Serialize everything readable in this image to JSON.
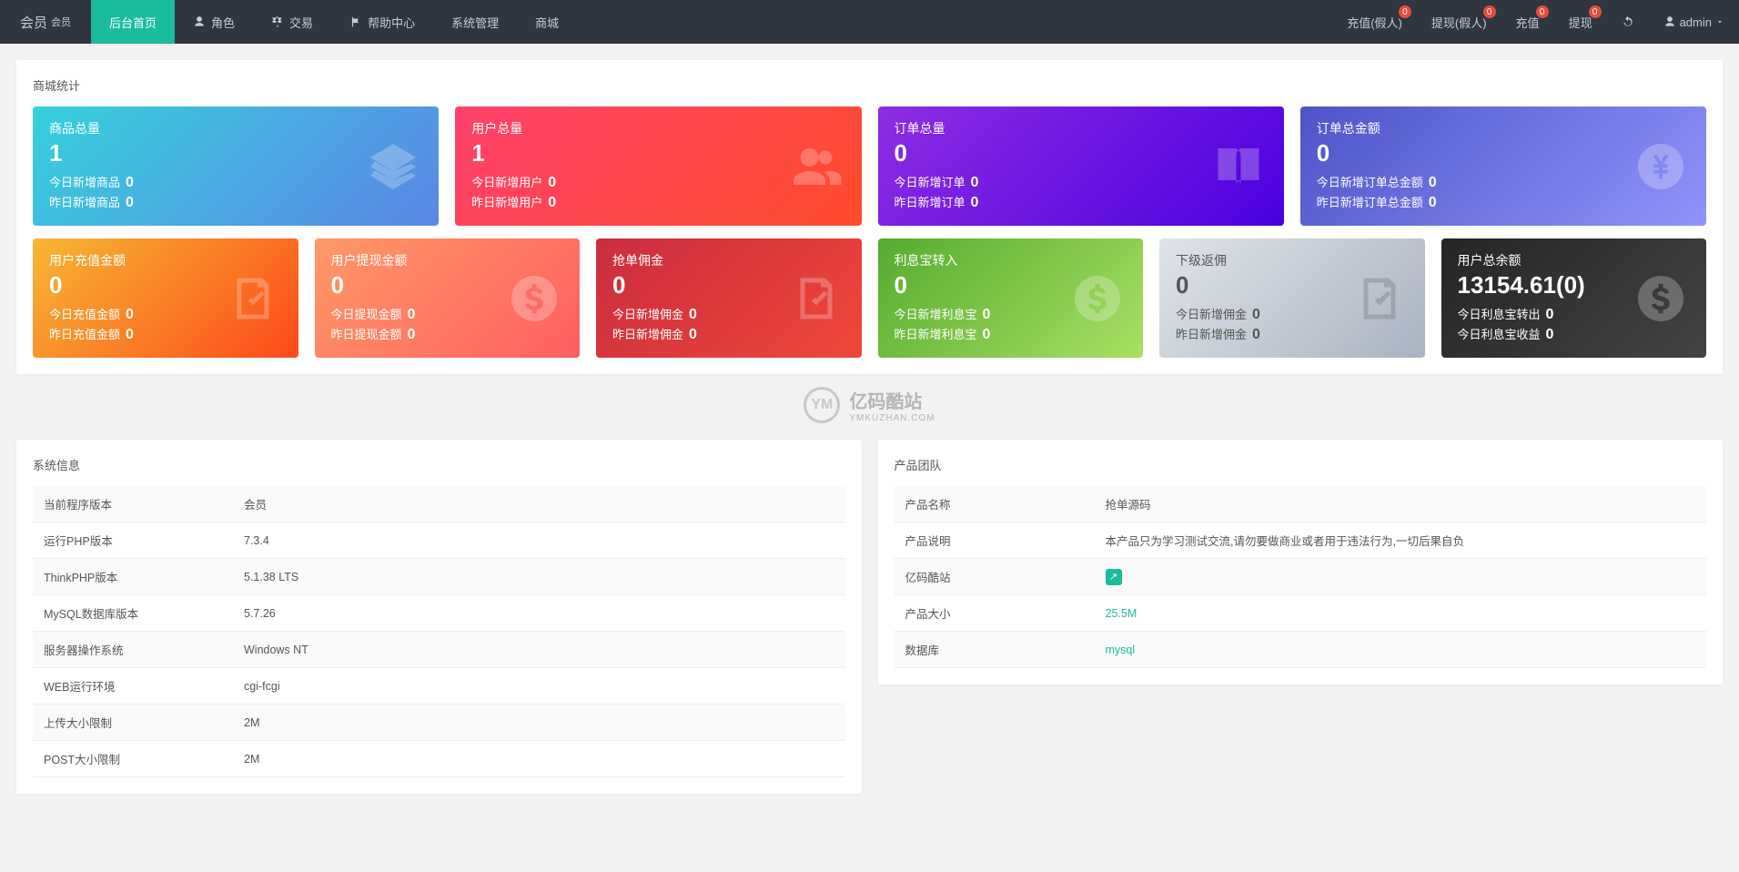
{
  "brand": {
    "main": "会员",
    "sub": "会员"
  },
  "nav": [
    {
      "label": "后台首页",
      "icon": "",
      "active": true
    },
    {
      "label": "角色",
      "icon": "user"
    },
    {
      "label": "交易",
      "icon": "scale"
    },
    {
      "label": "帮助中心",
      "icon": "flag"
    },
    {
      "label": "系统管理",
      "icon": ""
    },
    {
      "label": "商城",
      "icon": ""
    }
  ],
  "rightNav": [
    {
      "label": "充值(假人)",
      "badge": "0"
    },
    {
      "label": "提现(假人)",
      "badge": "0"
    },
    {
      "label": "充值",
      "badge": "0"
    },
    {
      "label": "提现",
      "badge": "0"
    }
  ],
  "refreshIcon": "refresh",
  "user": {
    "name": "admin",
    "icon": "user"
  },
  "statsPanelTitle": "商城统计",
  "watermark": {
    "cn": "亿码酷站",
    "en": "YMKUZHAN.COM",
    "logo": "YM"
  },
  "cardsTop": [
    {
      "title": "商品总量",
      "big": "1",
      "l1": "今日新增商品",
      "v1": "0",
      "l2": "昨日新增商品",
      "v2": "0",
      "gradient": "g-cyan",
      "icon": "layers"
    },
    {
      "title": "用户总量",
      "big": "1",
      "l1": "今日新增用户",
      "v1": "0",
      "l2": "昨日新增用户",
      "v2": "0",
      "gradient": "g-pink",
      "icon": "users"
    },
    {
      "title": "订单总量",
      "big": "0",
      "l1": "今日新增订单",
      "v1": "0",
      "l2": "昨日新增订单",
      "v2": "0",
      "gradient": "g-purple",
      "icon": "book"
    },
    {
      "title": "订单总金额",
      "big": "0",
      "l1": "今日新增订单总金额",
      "v1": "0",
      "l2": "昨日新增订单总金额",
      "v2": "0",
      "gradient": "g-blue",
      "icon": "yen"
    }
  ],
  "cardsBottom": [
    {
      "title": "用户充值金额",
      "big": "0",
      "l1": "今日充值金额",
      "v1": "0",
      "l2": "昨日充值金额",
      "v2": "0",
      "gradient": "g-yellow",
      "icon": "note"
    },
    {
      "title": "用户提现金额",
      "big": "0",
      "l1": "今日提现金额",
      "v1": "0",
      "l2": "昨日提现金额",
      "v2": "0",
      "gradient": "g-orange",
      "icon": "dollar"
    },
    {
      "title": "抢单佣金",
      "big": "0",
      "l1": "今日新增佣金",
      "v1": "0",
      "l2": "昨日新增佣金",
      "v2": "0",
      "gradient": "g-red",
      "icon": "note"
    },
    {
      "title": "利息宝转入",
      "big": "0",
      "l1": "今日新增利息宝",
      "v1": "0",
      "l2": "昨日新增利息宝",
      "v2": "0",
      "gradient": "g-green",
      "icon": "dollar"
    },
    {
      "title": "下级返佣",
      "big": "0",
      "l1": "今日新增佣金",
      "v1": "0",
      "l2": "昨日新增佣金",
      "v2": "0",
      "gradient": "g-grey2",
      "icon": "note"
    },
    {
      "title": "用户总余额",
      "big": "13154.61(0)",
      "l1": "今日利息宝转出",
      "v1": "0",
      "l2": "今日利息宝收益",
      "v2": "0",
      "gradient": "g-dark",
      "icon": "dollar"
    }
  ],
  "sysInfoTitle": "系统信息",
  "sysInfo": [
    {
      "k": "当前程序版本",
      "v": "会员"
    },
    {
      "k": "运行PHP版本",
      "v": "7.3.4"
    },
    {
      "k": "ThinkPHP版本",
      "v": "5.1.38 LTS"
    },
    {
      "k": "MySQL数据库版本",
      "v": "5.7.26"
    },
    {
      "k": "服务器操作系统",
      "v": "Windows NT"
    },
    {
      "k": "WEB运行环境",
      "v": "cgi-fcgi"
    },
    {
      "k": "上传大小限制",
      "v": "2M"
    },
    {
      "k": "POST大小限制",
      "v": "2M"
    }
  ],
  "teamTitle": "产品团队",
  "team": [
    {
      "k": "产品名称",
      "v": "抢单源码",
      "link": false
    },
    {
      "k": "产品说明",
      "v": "本产品只为学习测试交流,请勿要做商业或者用于违法行为,一切后果自负",
      "link": false
    },
    {
      "k": "亿码酷站",
      "v": "img",
      "link": true,
      "isImg": true
    },
    {
      "k": "产品大小",
      "v": "25.5M",
      "link": true
    },
    {
      "k": "数据库",
      "v": "mysql",
      "link": true
    }
  ]
}
